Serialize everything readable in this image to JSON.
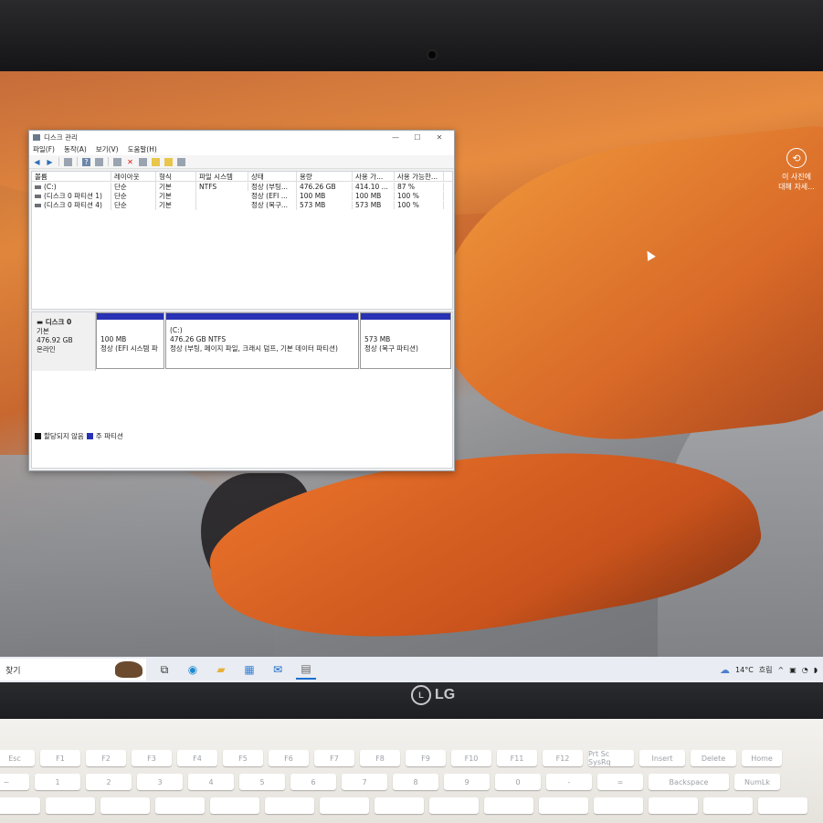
{
  "desktop": {
    "photo_info": {
      "line1": "이 사진에",
      "line2": "대해 자세..."
    }
  },
  "window": {
    "title": "디스크 관리",
    "controls": {
      "minimize": "—",
      "maximize": "☐",
      "close": "✕"
    },
    "menu": [
      "파일(F)",
      "동작(A)",
      "보기(V)",
      "도움말(H)"
    ],
    "columns": [
      "볼륨",
      "레이아웃",
      "형식",
      "파일 시스템",
      "상태",
      "용량",
      "사용 가...",
      "사용 가능한..."
    ],
    "volumes": [
      [
        "(C:)",
        "단순",
        "기본",
        "NTFS",
        "정상 (부팅...",
        "476.26 GB",
        "414.10 ...",
        "87 %"
      ],
      [
        "(디스크 0 파티션 1)",
        "단순",
        "기본",
        "",
        "정상 (EFI ...",
        "100 MB",
        "100 MB",
        "100 %"
      ],
      [
        "(디스크 0 파티션 4)",
        "단순",
        "기본",
        "",
        "정상 (복구...",
        "573 MB",
        "573 MB",
        "100 %"
      ]
    ],
    "disk": {
      "name": "디스크 0",
      "type": "기본",
      "size": "476.92 GB",
      "status": "온라인",
      "partitions": [
        {
          "title": "",
          "size": "100 MB",
          "status": "정상 (EFI 시스템 파"
        },
        {
          "title": "(C:)",
          "size": "476.26 GB NTFS",
          "status": "정상 (부팅, 페이지 파일, 크래시 덤프, 기본 데이터 파티션)"
        },
        {
          "title": "",
          "size": "573 MB",
          "status": "정상 (복구 파티션)"
        }
      ]
    },
    "legend": [
      {
        "label": "할당되지 않음",
        "color": "#111111"
      },
      {
        "label": "주 파티션",
        "color": "#2832b4"
      }
    ]
  },
  "taskbar": {
    "search_label": "찾기",
    "apps": [
      "task-view-icon",
      "edge-icon",
      "file-explorer-icon",
      "store-icon",
      "mail-icon",
      "disk-management-icon"
    ],
    "weather": {
      "temp": "14°C",
      "condition": "흐림"
    },
    "tray_chevron": "^"
  },
  "brand": {
    "logo": "LG"
  },
  "keyboard": {
    "row1": [
      "Esc",
      "F1",
      "F2",
      "F3",
      "F4",
      "F5",
      "F6",
      "F7",
      "F8",
      "F9",
      "F10",
      "F11",
      "F12",
      "Prt Sc SysRq",
      "Insert",
      "Delete",
      "Home"
    ],
    "row2": [
      "~",
      "1",
      "2",
      "3",
      "4",
      "5",
      "6",
      "7",
      "8",
      "9",
      "0",
      "-",
      "=",
      "Backspace",
      "NumLk"
    ]
  },
  "colors": {
    "partition_bar": "#2832b4",
    "accent": "#1a6fd0"
  }
}
